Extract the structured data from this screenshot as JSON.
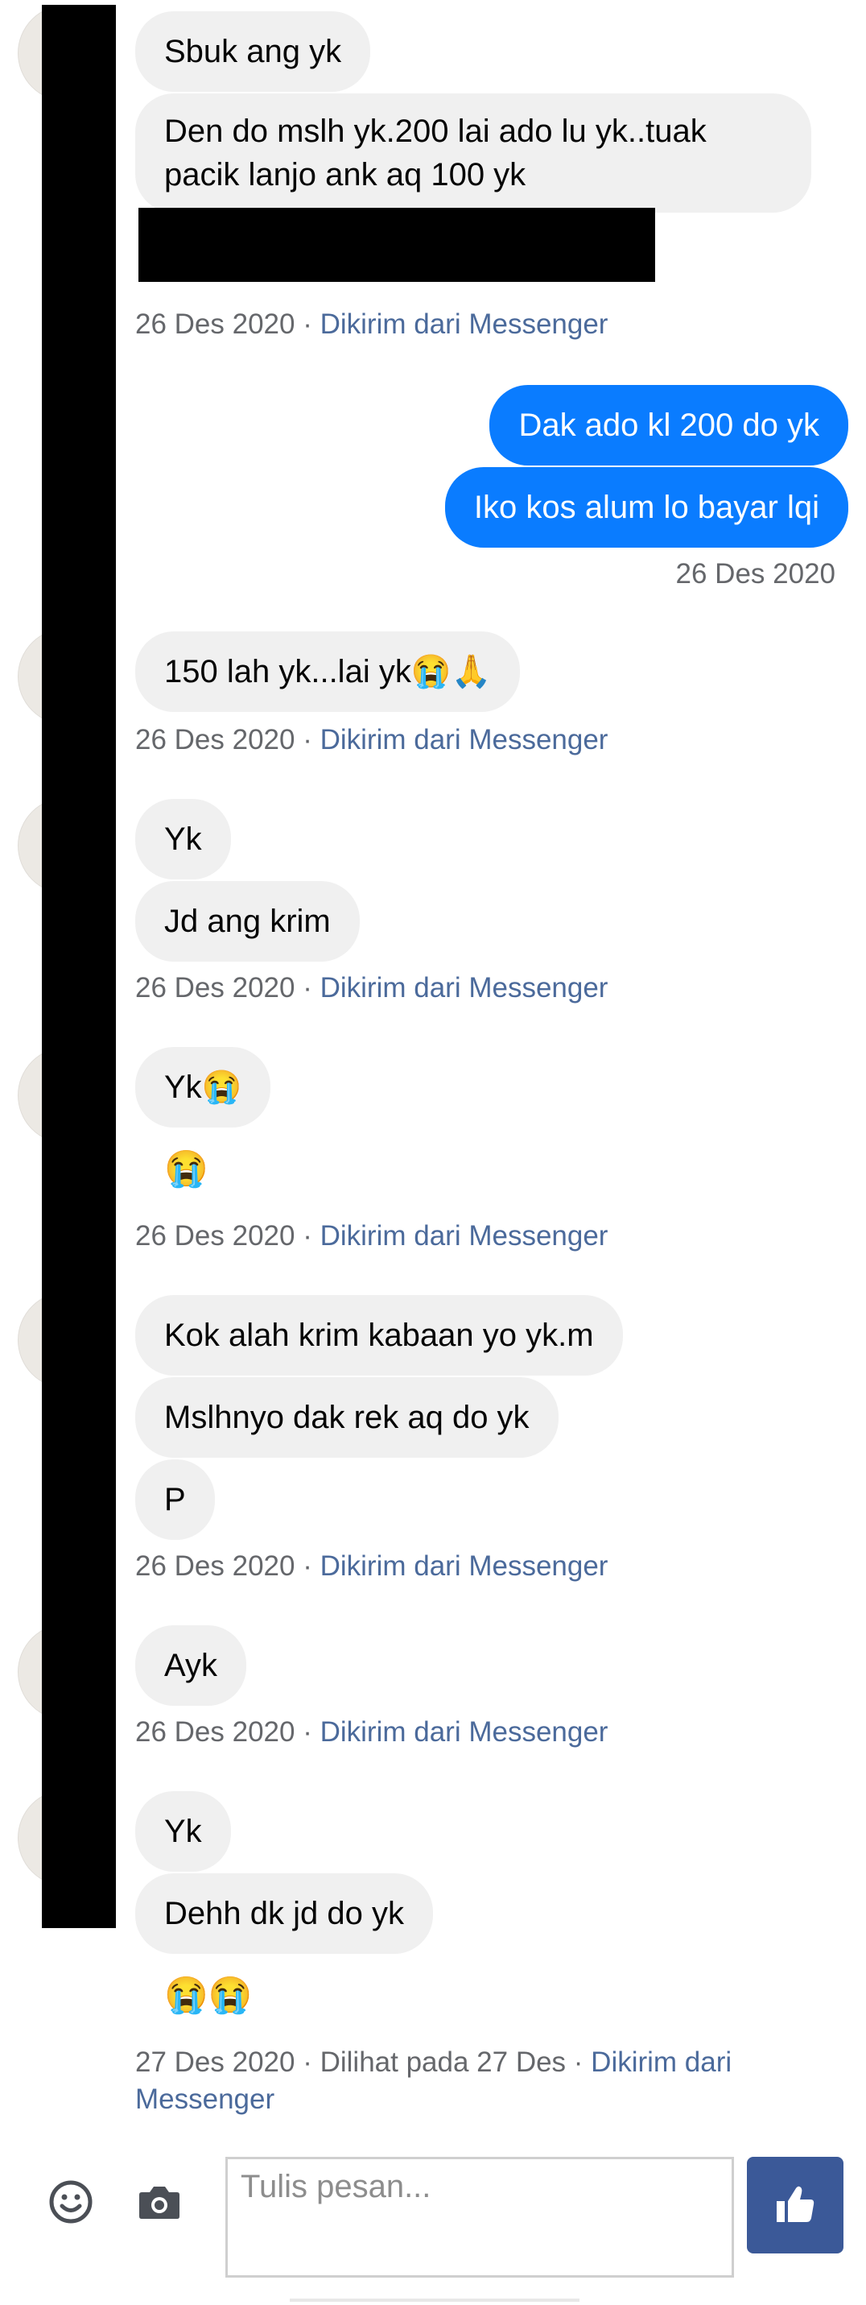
{
  "contact": {
    "name_redacted": true
  },
  "messages": {
    "m1": "Sbuk ang yk",
    "m2": "Den do mslh yk.200 lai ado lu yk..tuak pacik lanjo ank aq 100 yk",
    "m3": "Dak ado kl 200 do yk",
    "m4": "Iko kos alum lo bayar lqi",
    "m5": "150 lah yk...lai yk😭🙏",
    "m6": "Yk",
    "m7": "Jd ang krim",
    "m8": "Yk😭",
    "m9": "😭",
    "m10": "Kok alah krim kabaan yo yk.m",
    "m11": "Mslhnyo dak rek aq do yk",
    "m12": "P",
    "m13": "Ayk",
    "m14": "Yk",
    "m15": "Dehh dk jd do yk",
    "m16": "😭😭"
  },
  "meta": {
    "date_1": "26 Des 2020",
    "date_2": "27 Des 2020",
    "sep": " · ",
    "sent_from": "Dikirim dari Messenger",
    "seen": "Dilihat pada 27 Des",
    "sent_from_part1": "Dikirim dari",
    "sent_from_part2": "Messenger"
  },
  "composer": {
    "placeholder": "Tulis pesan...",
    "emoji_icon": "smiley-icon",
    "camera_icon": "camera-icon",
    "like_icon": "thumbs-up-icon"
  },
  "colors": {
    "outgoing_bubble": "#0a7cff",
    "incoming_bubble": "#f0f0f0",
    "link_blue": "#4b6a9b",
    "like_button": "#3b5998"
  }
}
